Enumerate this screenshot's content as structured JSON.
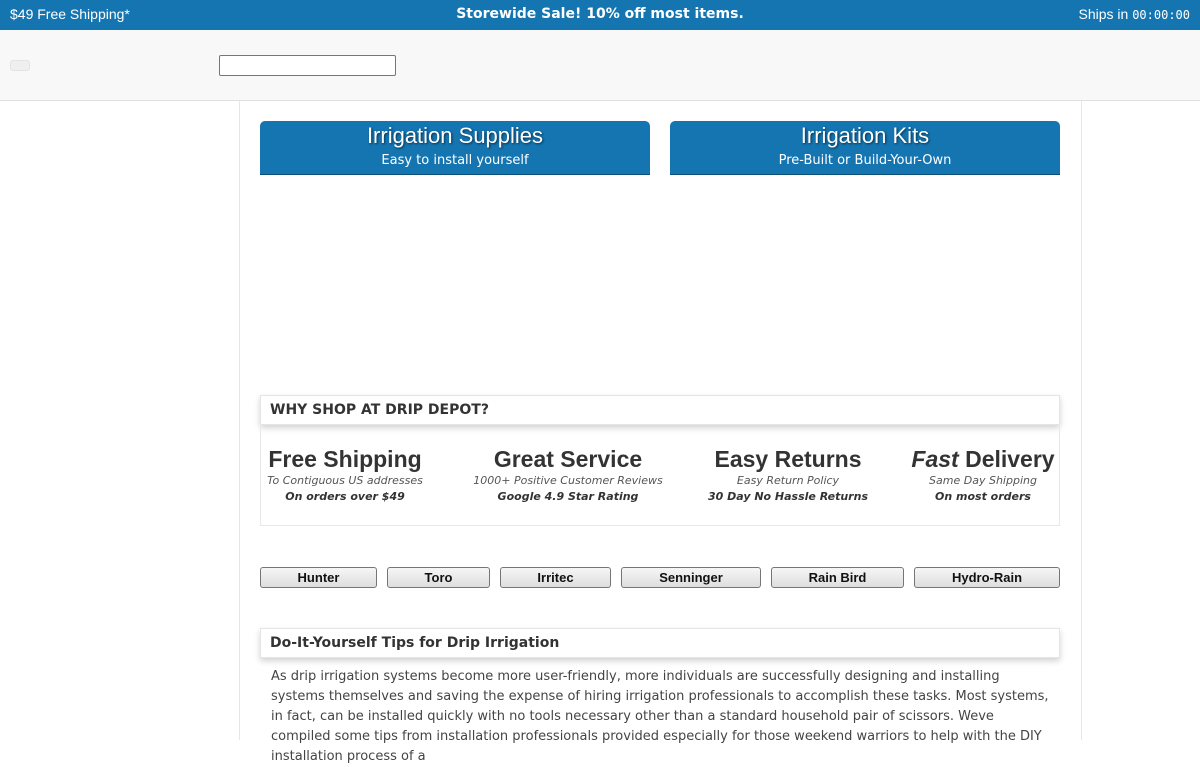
{
  "topbar": {
    "shipping": "$49 Free Shipping*",
    "sale": "Storewide Sale! 10% off most items.",
    "ships_label": "Ships in",
    "ships_timer": "00:00:00",
    "color": "#1475b1"
  },
  "search": {
    "placeholder": ""
  },
  "hero": {
    "supplies": {
      "title": "Irrigation Supplies",
      "subtitle": "Easy to install yourself"
    },
    "kits": {
      "title": "Irrigation Kits",
      "subtitle": "Pre-Built or Build-Your-Own"
    }
  },
  "why": {
    "heading": "WHY SHOP AT DRIP DEPOT?",
    "features": [
      {
        "title": "Free Shipping",
        "sub": "To Contiguous US addresses",
        "bold": "On orders over $49"
      },
      {
        "title": "Great Service",
        "sub": "1000+ Positive Customer Reviews",
        "bold": "Google 4.9 Star Rating"
      },
      {
        "title": "Easy Returns",
        "sub": "Easy Return Policy",
        "bold": "30 Day No Hassle Returns"
      },
      {
        "title_em": "Fast",
        "title": " Delivery",
        "sub": "Same Day Shipping",
        "bold": "On most orders"
      }
    ]
  },
  "brands": [
    "Hunter",
    "Toro",
    "Irritec",
    "Senninger",
    "Rain Bird",
    "Hydro-Rain"
  ],
  "tips": {
    "heading": "Do-It-Yourself Tips for Drip Irrigation",
    "body": "As drip irrigation systems become more user-friendly, more individuals are successfully designing and installing systems themselves and saving the expense of hiring irrigation professionals to accomplish these tasks. Most systems, in fact, can be installed quickly with no tools necessary other than a standard household pair of scissors. Weve compiled some tips from installation professionals provided especially for those weekend warriors to help with the DIY installation process of a"
  }
}
